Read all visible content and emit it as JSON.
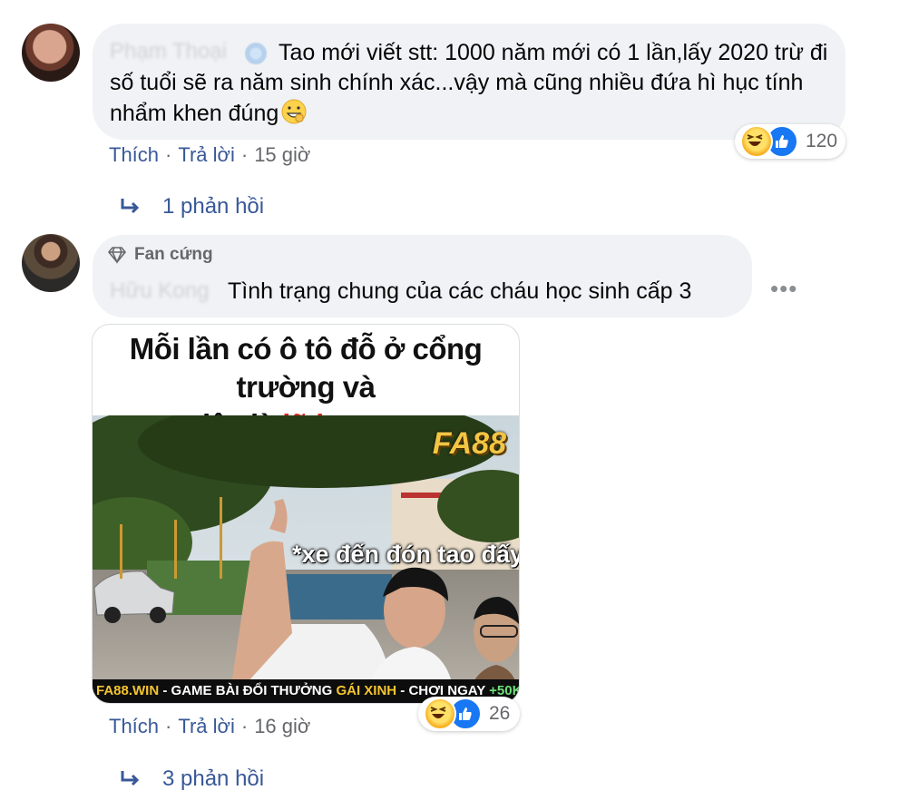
{
  "comment1": {
    "author": "Phạm Thoại",
    "text": "Tao mới viết stt: 1000 năm mới có 1 lần,lấy 2020 trừ đi số tuổi sẽ ra năm sinh chính xác...vậy mà cũng nhiều đứa hì hục tính nhẩm khen đúng",
    "reaction_count": "120",
    "like_label": "Thích",
    "reply_label": "Trả lời",
    "time": "15 giờ",
    "replies_label": "1 phản hồi"
  },
  "comment2": {
    "badge": "Fan cứng",
    "author": "Hữu Kong",
    "text": "Tình trạng chung của các cháu học sinh cấp 3",
    "more_label": "•••",
    "reaction_count": "26",
    "like_label": "Thích",
    "reply_label": "Trả lời",
    "time": "16 giờ",
    "replies_label": "3 phản hồi",
    "image": {
      "caption_line1": "Mỗi lần có ô tô đỗ ở cổng trường và",
      "caption_line2_prefix": "đây là",
      "caption_line2_red": "lũ bạn tao",
      "overlay_caption": "*xe đến đón tao đấy",
      "logo": "FA88",
      "banner_site": "FA88.WIN",
      "banner_text": "- GAME BÀI ĐỔI THƯỞNG",
      "banner_highlight": "GÁI XINH",
      "banner_cta": "- CHƠI NGAY",
      "banner_bonus": "+50K"
    }
  },
  "colors": {
    "bubble": "#f0f2f5",
    "link": "#385898",
    "meta": "#65676b",
    "like_blue": "#1877f2",
    "haha_yellow": "#f7b125"
  },
  "icons": [
    "haha-reaction-icon",
    "like-reaction-icon",
    "reply-arrow-icon",
    "diamond-badge-icon",
    "verified-badge-icon",
    "more-options-icon"
  ]
}
